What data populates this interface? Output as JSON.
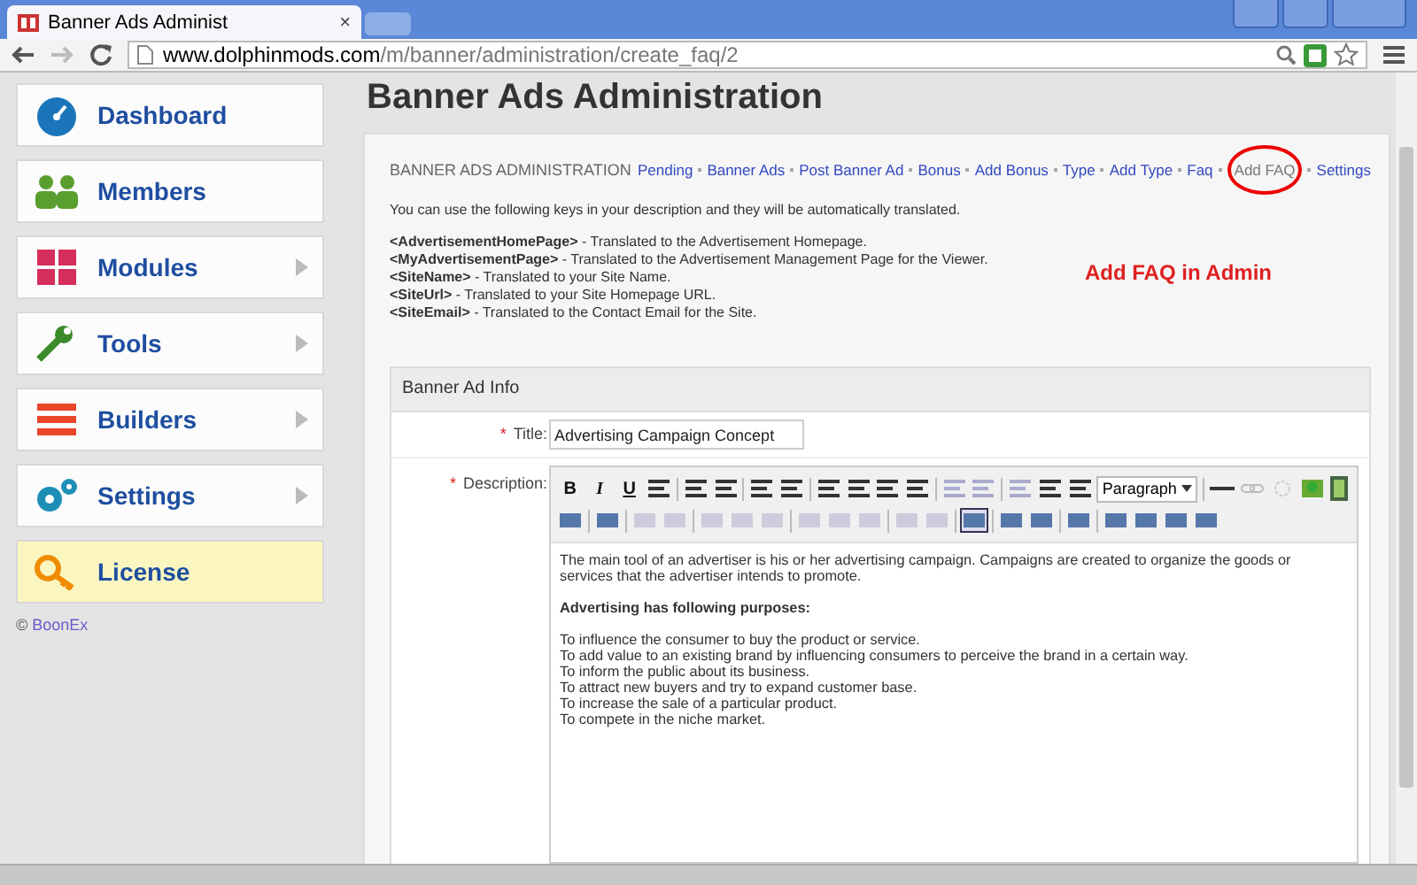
{
  "browser": {
    "tab_title": "Banner Ads Administ",
    "close": "×",
    "url_host": "www.dolphinmods.com",
    "url_path": "/m/banner/administration/create_faq/2"
  },
  "sidebar": {
    "items": [
      {
        "label": "Dashboard",
        "has_arrow": false,
        "highlighted": false
      },
      {
        "label": "Members",
        "has_arrow": false,
        "highlighted": false
      },
      {
        "label": "Modules",
        "has_arrow": true,
        "highlighted": false
      },
      {
        "label": "Tools",
        "has_arrow": true,
        "highlighted": false
      },
      {
        "label": "Builders",
        "has_arrow": true,
        "highlighted": false
      },
      {
        "label": "Settings",
        "has_arrow": true,
        "highlighted": false
      },
      {
        "label": "License",
        "has_arrow": false,
        "highlighted": true
      }
    ],
    "copyright": "©",
    "copyright_link": "BoonEx"
  },
  "page_title": "Banner Ads Administration",
  "panel": {
    "heading": "BANNER ADS ADMINISTRATION",
    "links": [
      {
        "label": "Pending",
        "selected": false
      },
      {
        "label": "Banner Ads",
        "selected": false
      },
      {
        "label": "Post Banner Ad",
        "selected": false
      },
      {
        "label": "Bonus",
        "selected": false
      },
      {
        "label": "Add Bonus",
        "selected": false
      },
      {
        "label": "Type",
        "selected": false
      },
      {
        "label": "Add Type",
        "selected": false
      },
      {
        "label": "Faq",
        "selected": false
      },
      {
        "label": "Add FAQ",
        "selected": true
      },
      {
        "label": "Settings",
        "selected": false
      }
    ],
    "intro": "You can use the following keys in your description and they will be automatically translated.",
    "keys": [
      {
        "key": "<AdvertisementHomePage>",
        "text": " - Translated to the Advertisement Homepage."
      },
      {
        "key": "<MyAdvertisementPage>",
        "text": " - Translated to the Advertisement Management Page for the Viewer."
      },
      {
        "key": "<SiteName>",
        "text": " - Translated to your Site Name."
      },
      {
        "key": "<SiteUrl>",
        "text": " - Translated to your Site Homepage URL."
      },
      {
        "key": "<SiteEmail>",
        "text": " - Translated to the Contact Email for the Site."
      }
    ],
    "annotation": "Add FAQ in Admin"
  },
  "form": {
    "section": "Banner Ad Info",
    "required_mark": "*",
    "title_label": "Title:",
    "title_value": "Advertising Campaign Concept",
    "description_label": "Description:",
    "toolbar": {
      "bold": "B",
      "italic": "I",
      "underline": "U",
      "format": "Paragraph"
    },
    "editor_paragraphs": [
      {
        "kind": "text",
        "text": "The main tool of an advertiser is his or her advertising campaign. Campaigns are created to organize the goods or services that the advertiser intends to promote."
      },
      {
        "kind": "heading",
        "text": "Advertising has following purposes:"
      },
      {
        "kind": "lines",
        "lines": [
          "To influence the consumer to buy the product or service.",
          "To add value to an existing brand by influencing consumers to perceive the brand in a certain way.",
          "To inform the public about its business.",
          "To attract new buyers and try to expand customer base.",
          "To increase the sale of a particular product.",
          "To compete in the niche market."
        ]
      }
    ]
  }
}
